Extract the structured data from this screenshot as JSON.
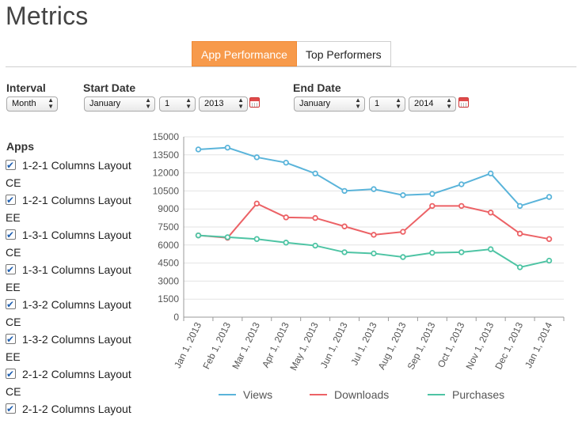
{
  "page": {
    "title": "Metrics"
  },
  "tabs": [
    {
      "label": "App Performance",
      "active": true
    },
    {
      "label": "Top Performers",
      "active": false
    }
  ],
  "filters": {
    "interval": {
      "label": "Interval",
      "value": "Month"
    },
    "start": {
      "label": "Start Date",
      "month": "January",
      "day": "1",
      "year": "2013",
      "icon": "calendar-icon"
    },
    "end": {
      "label": "End Date",
      "month": "January",
      "day": "1",
      "year": "2014",
      "icon": "calendar-icon"
    }
  },
  "apps": {
    "title": "Apps",
    "items": [
      {
        "label": "1-2-1 Columns Layout CE",
        "checked": true
      },
      {
        "label": "1-2-1 Columns Layout EE",
        "checked": true
      },
      {
        "label": "1-3-1 Columns Layout CE",
        "checked": true
      },
      {
        "label": "1-3-1 Columns Layout EE",
        "checked": true
      },
      {
        "label": "1-3-2 Columns Layout CE",
        "checked": true
      },
      {
        "label": "1-3-2 Columns Layout EE",
        "checked": true
      },
      {
        "label": "2-1-2 Columns Layout CE",
        "checked": true
      },
      {
        "label": "2-1-2 Columns Layout",
        "checked": true
      }
    ]
  },
  "chart_data": {
    "type": "line",
    "categories": [
      "Jan 1, 2013",
      "Feb 1, 2013",
      "Mar 1, 2013",
      "Apr 1, 2013",
      "May 1, 2013",
      "Jun 1, 2013",
      "Jul 1, 2013",
      "Aug 1, 2013",
      "Sep 1, 2013",
      "Oct 1, 2013",
      "Nov 1, 2013",
      "Dec 1, 2013",
      "Jan 1, 2014"
    ],
    "yticks": [
      "0",
      "1500",
      "3000",
      "4500",
      "6000",
      "7500",
      "9000",
      "10500",
      "12000",
      "13500",
      "15000"
    ],
    "ylim": [
      0,
      15000
    ],
    "grid": true,
    "legend": "bottom",
    "series": [
      {
        "name": "Views",
        "color": "#5ab4da",
        "values": [
          13950,
          14100,
          13300,
          12850,
          11950,
          10500,
          10650,
          10150,
          10250,
          11050,
          11950,
          9250,
          10000
        ]
      },
      {
        "name": "Downloads",
        "color": "#ec6266",
        "values": [
          6800,
          6600,
          9450,
          8300,
          8250,
          7550,
          6850,
          7100,
          9250,
          9250,
          8700,
          6950,
          6500
        ]
      },
      {
        "name": "Purchases",
        "color": "#4ec4a4",
        "values": [
          6800,
          6650,
          6500,
          6200,
          5950,
          5400,
          5300,
          5000,
          5350,
          5400,
          5650,
          4150,
          4700
        ]
      }
    ]
  }
}
